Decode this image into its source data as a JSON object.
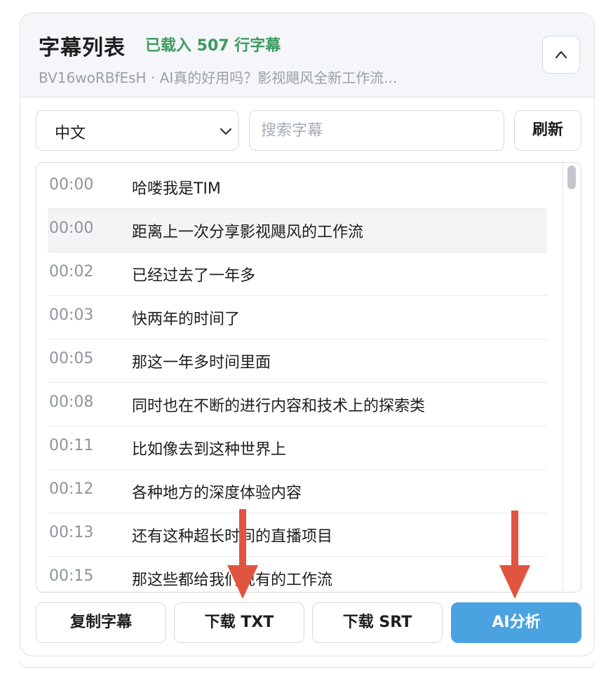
{
  "header": {
    "title": "字幕列表",
    "loaded_status": "已载入 507 行字幕",
    "subtitle": "BV16woRBfEsH · AI真的好用吗？影视飓风全新工作流..."
  },
  "controls": {
    "language_selected": "中文",
    "search_placeholder": "搜索字幕",
    "refresh_label": "刷新"
  },
  "subtitles": [
    {
      "time": "00:00",
      "text": "哈喽我是TIM"
    },
    {
      "time": "00:00",
      "text": "距离上一次分享影视飓风的工作流"
    },
    {
      "time": "00:02",
      "text": "已经过去了一年多"
    },
    {
      "time": "00:03",
      "text": "快两年的时间了"
    },
    {
      "time": "00:05",
      "text": "那这一年多时间里面"
    },
    {
      "time": "00:08",
      "text": "同时也在不断的进行内容和技术上的探索类"
    },
    {
      "time": "00:11",
      "text": "比如像去到这种世界上"
    },
    {
      "time": "00:12",
      "text": "各种地方的深度体验内容"
    },
    {
      "time": "00:13",
      "text": "还有这种超长时间的直播项目"
    },
    {
      "time": "00:15",
      "text": "那这些都给我们现有的工作流"
    }
  ],
  "actions": {
    "copy_label": "复制字幕",
    "download_txt_label": "下载 TXT",
    "download_srt_label": "下载 SRT",
    "ai_label": "AI分析"
  },
  "colors": {
    "accent_green": "#3c9a5f",
    "primary_blue": "#4aa3e0",
    "annotation_red": "#e0553f"
  }
}
